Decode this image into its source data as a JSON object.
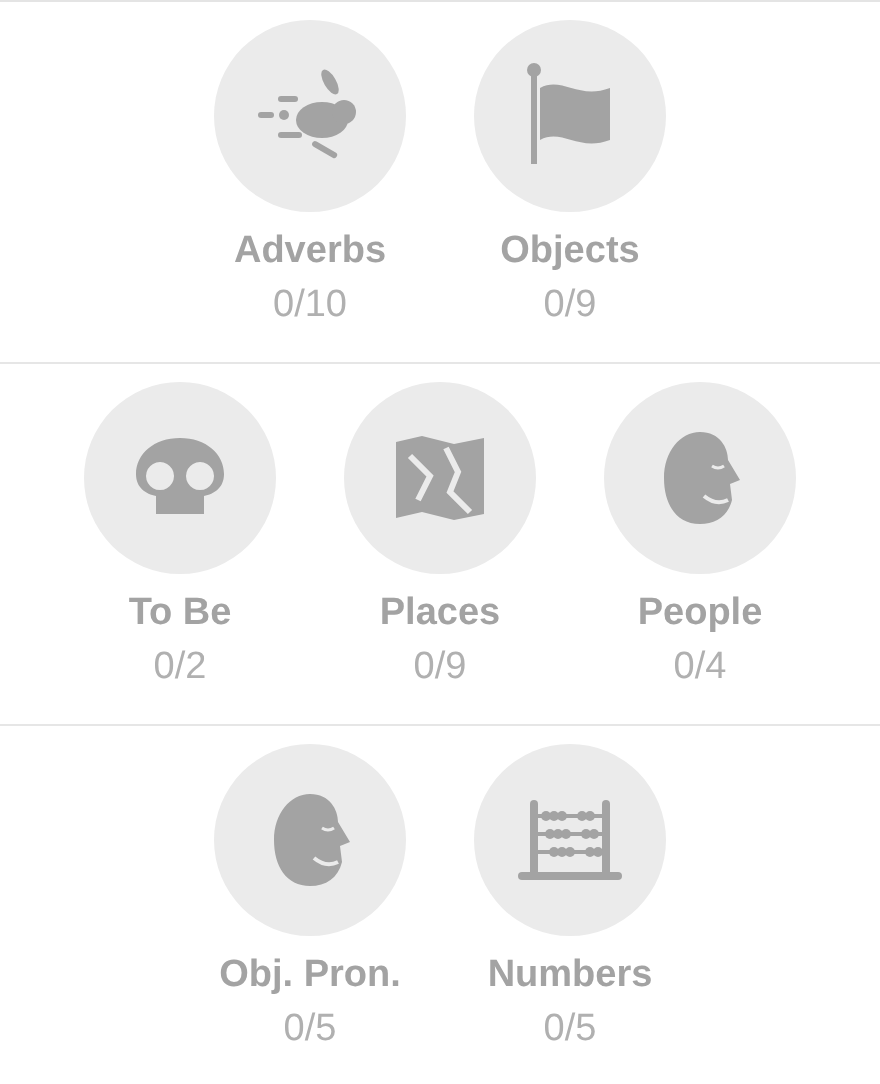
{
  "rows": [
    {
      "skills": [
        {
          "name": "Adverbs",
          "progress": "0/10",
          "kind": "rabbit"
        },
        {
          "name": "Objects",
          "progress": "0/9",
          "kind": "flag"
        }
      ]
    },
    {
      "skills": [
        {
          "name": "To Be",
          "progress": "0/2",
          "kind": "skull"
        },
        {
          "name": "Places",
          "progress": "0/9",
          "kind": "map"
        },
        {
          "name": "People",
          "progress": "0/4",
          "kind": "head"
        }
      ]
    },
    {
      "skills": [
        {
          "name": "Obj. Pron.",
          "progress": "0/5",
          "kind": "head"
        },
        {
          "name": "Numbers",
          "progress": "0/5",
          "kind": "abacus"
        }
      ]
    }
  ]
}
